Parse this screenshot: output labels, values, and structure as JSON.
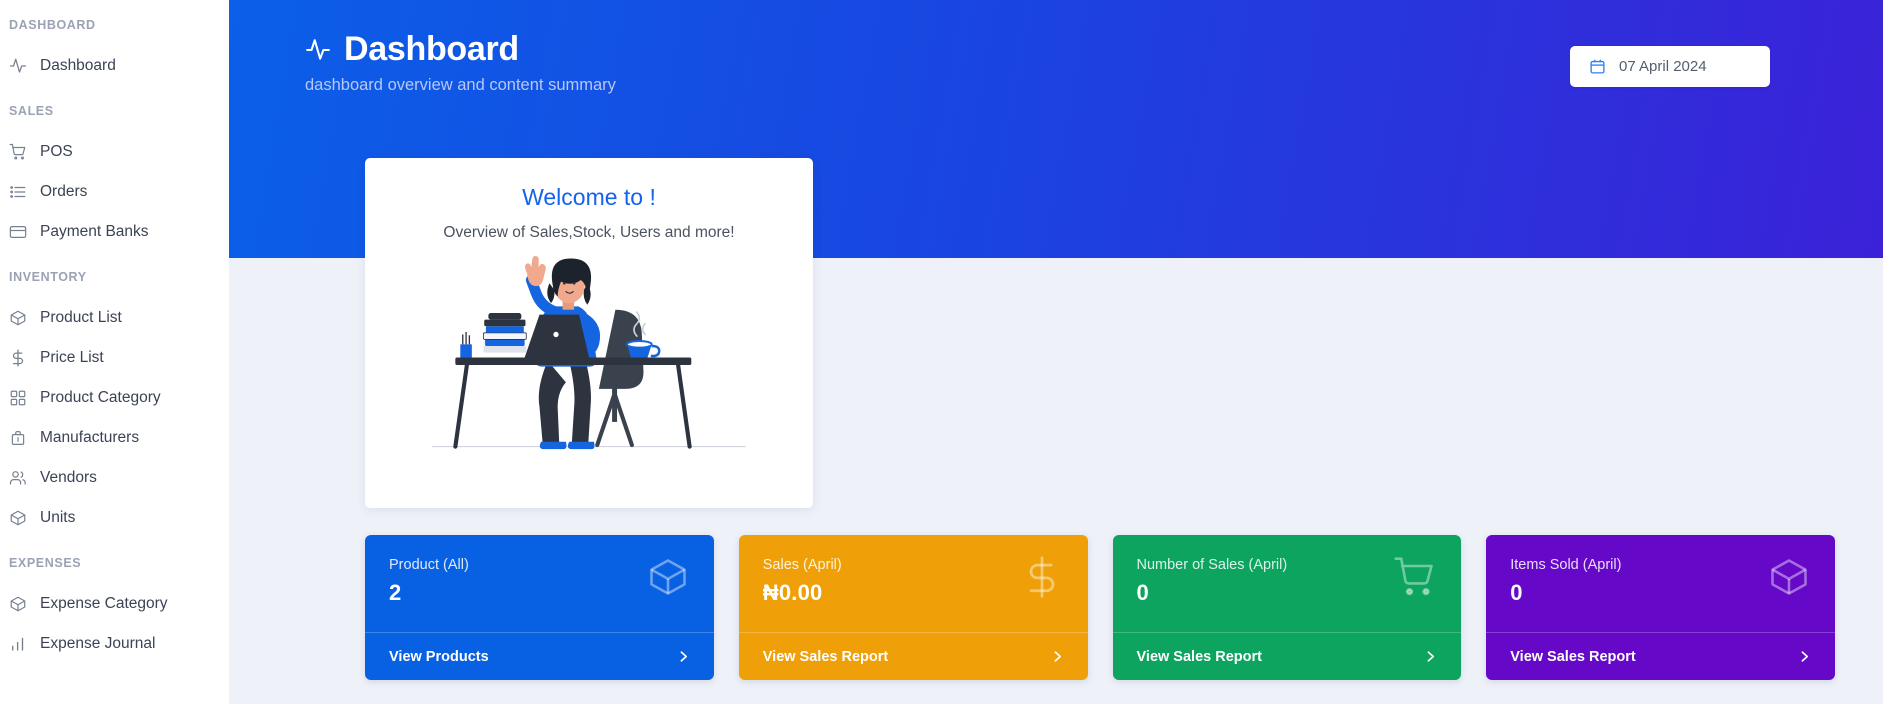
{
  "sidebar": {
    "sections": [
      {
        "label": "DASHBOARD",
        "items": [
          {
            "label": "Dashboard",
            "icon": "activity-pulse-icon"
          }
        ]
      },
      {
        "label": "SALES",
        "items": [
          {
            "label": "POS",
            "icon": "shopping-cart-icon"
          },
          {
            "label": "Orders",
            "icon": "list-icon"
          },
          {
            "label": "Payment Banks",
            "icon": "credit-card-icon"
          }
        ]
      },
      {
        "label": "INVENTORY",
        "items": [
          {
            "label": "Product List",
            "icon": "box-icon"
          },
          {
            "label": "Price List",
            "icon": "dollar-icon"
          },
          {
            "label": "Product Category",
            "icon": "grid-icon"
          },
          {
            "label": "Manufacturers",
            "icon": "briefcase-icon"
          },
          {
            "label": "Vendors",
            "icon": "users-icon"
          },
          {
            "label": "Units",
            "icon": "box-icon"
          }
        ]
      },
      {
        "label": "EXPENSES",
        "items": [
          {
            "label": "Expense Category",
            "icon": "box-icon"
          },
          {
            "label": "Expense Journal",
            "icon": "bar-chart-icon"
          }
        ]
      }
    ]
  },
  "header": {
    "title": "Dashboard",
    "title_icon": "activity-pulse-icon",
    "subtitle": "dashboard overview and content summary",
    "datepicker": {
      "value": "07 April 2024",
      "icon": "calendar-icon"
    },
    "gradient_from": "#0B5FE8",
    "gradient_to": "#3B22D8"
  },
  "welcome": {
    "title": "Welcome to !",
    "subtitle": "Overview of Sales,Stock, Users and more!",
    "title_color": "#1463EF",
    "illustration": "woman-waving-at-desk-illustration"
  },
  "stats": [
    {
      "label": "Product (All)",
      "value": "2",
      "action": "View Products",
      "icon": "box-icon",
      "color": "#0861E2"
    },
    {
      "label": "Sales (April)",
      "value": "₦0.00",
      "action": "View Sales Report",
      "icon": "dollar-icon",
      "color": "#EFA008"
    },
    {
      "label": "Number of Sales (April)",
      "value": "0",
      "action": "View Sales Report",
      "icon": "shopping-cart-icon",
      "color": "#0CA45F"
    },
    {
      "label": "Items Sold (April)",
      "value": "0",
      "action": "View Sales Report",
      "icon": "box-icon",
      "color": "#6608C8"
    }
  ]
}
